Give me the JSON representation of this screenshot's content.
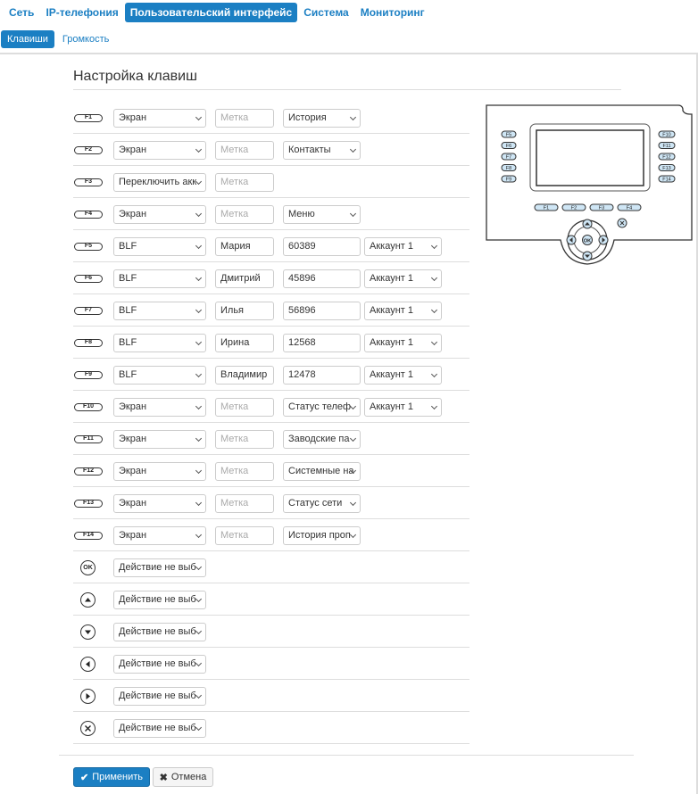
{
  "nav": {
    "tabs": [
      "Сеть",
      "IP-телефония",
      "Пользовательский интерфейс",
      "Система",
      "Мониторинг"
    ],
    "subtabs": [
      "Клавиши",
      "Громкость"
    ]
  },
  "page": {
    "title": "Настройка клавиш"
  },
  "rows": [
    {
      "key": "F1",
      "action": "Экран",
      "label": "Метка",
      "label_placeholder": true,
      "value": "История"
    },
    {
      "key": "F2",
      "action": "Экран",
      "label": "Метка",
      "label_placeholder": true,
      "value": "Контакты"
    },
    {
      "key": "F3",
      "action": "Переключить акк",
      "label": "Метка",
      "label_placeholder": true
    },
    {
      "key": "F4",
      "action": "Экран",
      "label": "Метка",
      "label_placeholder": true,
      "value": "Меню"
    },
    {
      "key": "F5",
      "action": "BLF",
      "label": "Мария",
      "number": "60389",
      "account": "Аккаунт 1"
    },
    {
      "key": "F6",
      "action": "BLF",
      "label": "Дмитрий",
      "number": "45896",
      "account": "Аккаунт 1"
    },
    {
      "key": "F7",
      "action": "BLF",
      "label": "Илья",
      "number": "56896",
      "account": "Аккаунт 1"
    },
    {
      "key": "F8",
      "action": "BLF",
      "label": "Ирина",
      "number": "12568",
      "account": "Аккаунт 1"
    },
    {
      "key": "F9",
      "action": "BLF",
      "label": "Владимир",
      "number": "12478",
      "account": "Аккаунт 1"
    },
    {
      "key": "F10",
      "action": "Экран",
      "label": "Метка",
      "label_placeholder": true,
      "value": "Статус телеф",
      "account": "Аккаунт 1"
    },
    {
      "key": "F11",
      "action": "Экран",
      "label": "Метка",
      "label_placeholder": true,
      "value": "Заводские па"
    },
    {
      "key": "F12",
      "action": "Экран",
      "label": "Метка",
      "label_placeholder": true,
      "value": "Системные на"
    },
    {
      "key": "F13",
      "action": "Экран",
      "label": "Метка",
      "label_placeholder": true,
      "value": "Статус сети"
    },
    {
      "key": "F14",
      "action": "Экран",
      "label": "Метка",
      "label_placeholder": true,
      "value": "История проп"
    },
    {
      "key": "OK",
      "round": "ok",
      "action": "Действие не выб"
    },
    {
      "key": "Up",
      "round": "up",
      "action": "Действие не выб"
    },
    {
      "key": "Down",
      "round": "down",
      "action": "Действие не выб"
    },
    {
      "key": "Left",
      "round": "left",
      "action": "Действие не выб"
    },
    {
      "key": "Right",
      "round": "right",
      "action": "Действие не выб"
    },
    {
      "key": "Cancel",
      "round": "cancel",
      "action": "Действие не выб"
    }
  ],
  "phone": {
    "left_keys": [
      "F5",
      "F6",
      "F7",
      "F8",
      "F9"
    ],
    "right_keys": [
      "F10",
      "F11",
      "F12",
      "F13",
      "F14"
    ],
    "bottom_keys": [
      "F1",
      "F2",
      "F3",
      "F4"
    ],
    "ok_label": "OK"
  },
  "buttons": {
    "apply": "Применить",
    "cancel": "Отмена"
  },
  "colors": {
    "accent": "#1b7fc3",
    "phone_key_fill": "#cfe6f5"
  }
}
